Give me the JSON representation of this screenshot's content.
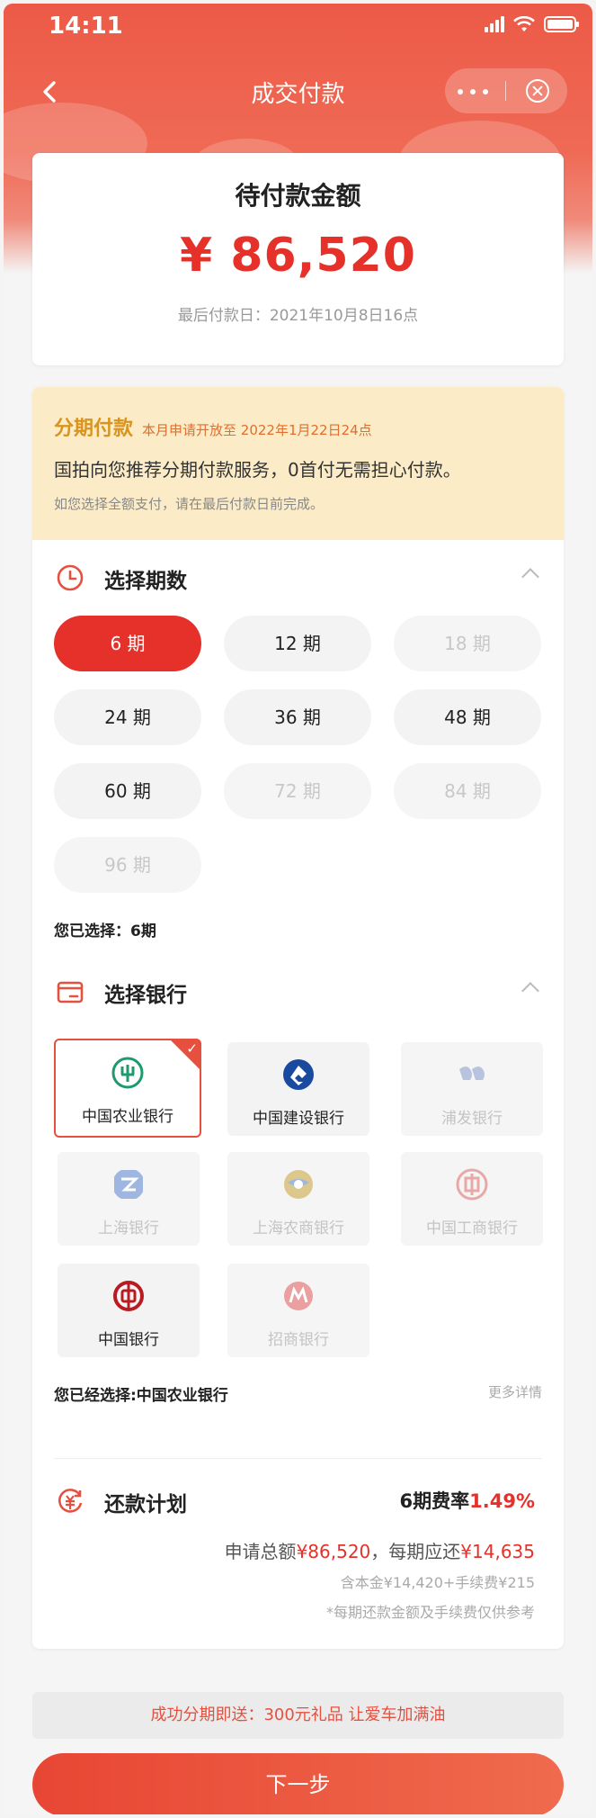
{
  "status_bar": {
    "time": "14:11"
  },
  "nav": {
    "title": "成交付款"
  },
  "payment": {
    "title": "待付款金额",
    "amount": "¥ 86,520",
    "deadline": "最后付款日：2021年10月8日16点"
  },
  "installment": {
    "title": "分期付款",
    "notice": "本月申请开放至 2022年1月22日24点",
    "recommend": "国拍向您推荐分期付款服务，0首付无需担心付款。",
    "hint": "如您选择全额支付，请在最后付款日前完成。"
  },
  "periods": {
    "title": "选择期数",
    "options": [
      {
        "label": "6 期",
        "state": "active"
      },
      {
        "label": "12 期",
        "state": "normal"
      },
      {
        "label": "18 期",
        "state": "disabled"
      },
      {
        "label": "24 期",
        "state": "normal"
      },
      {
        "label": "36 期",
        "state": "normal"
      },
      {
        "label": "48 期",
        "state": "normal"
      },
      {
        "label": "60 期",
        "state": "normal"
      },
      {
        "label": "72 期",
        "state": "disabled"
      },
      {
        "label": "84 期",
        "state": "disabled"
      },
      {
        "label": "96 期",
        "state": "disabled"
      }
    ],
    "selected_text": "您已选择：6期"
  },
  "banks": {
    "title": "选择银行",
    "items": [
      {
        "name": "中国农业银行",
        "icon": "abc-bank-icon",
        "state": "selected",
        "color": "#1e9a6e"
      },
      {
        "name": "中国建设银行",
        "icon": "ccb-bank-icon",
        "state": "normal",
        "color": "#1a4aa0"
      },
      {
        "name": "浦发银行",
        "icon": "spdb-bank-icon",
        "state": "disabled",
        "color": "#b8c4de"
      },
      {
        "name": "上海银行",
        "icon": "bos-bank-icon",
        "state": "disabled",
        "color": "#9fb6e0"
      },
      {
        "name": "上海农商银行",
        "icon": "srcb-bank-icon",
        "state": "disabled",
        "color": "#d9c48a"
      },
      {
        "name": "中国工商银行",
        "icon": "icbc-bank-icon",
        "state": "disabled",
        "color": "#e9a8a8"
      },
      {
        "name": "中国银行",
        "icon": "boc-bank-icon",
        "state": "normal",
        "color": "#b81c22"
      },
      {
        "name": "招商银行",
        "icon": "cmb-bank-icon",
        "state": "disabled",
        "color": "#eaa0a0"
      }
    ],
    "selected_text": "您已经选择:中国农业银行",
    "more_link": "更多详情"
  },
  "plan": {
    "title": "还款计划",
    "rate_prefix": "6期费率",
    "rate_value": "1.49%",
    "total_label": "申请总额",
    "total_value": "¥86,520",
    "per_label": "，每期应还",
    "per_value": "¥14,635",
    "breakdown": "含本金¥14,420+手续费¥215",
    "disclaimer": "*每期还款金额及手续费仅供参考"
  },
  "gift": {
    "text": "成功分期即送：300元礼品 让爱车加满油"
  },
  "next_button": {
    "label": "下一步"
  },
  "colors": {
    "brand": "#e6302a",
    "accent": "#e6503f",
    "banner": "#fbecc7"
  }
}
